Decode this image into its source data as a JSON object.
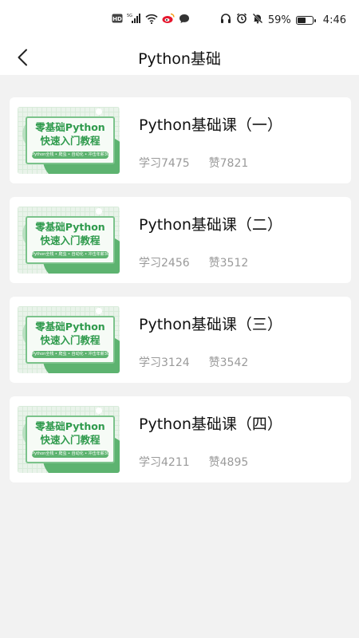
{
  "status_bar": {
    "network_label": "5G",
    "battery_percent": "59%",
    "battery_level": 0.59,
    "time": "4:46",
    "icons": [
      "hd-icon",
      "signal-icon",
      "wifi-icon",
      "weibo-icon",
      "chat-icon",
      "headphones-icon",
      "alarm-icon",
      "mute-icon",
      "battery-icon"
    ]
  },
  "nav": {
    "title": "Python基础"
  },
  "thumb": {
    "line1": "零基础Python",
    "line2": "快速入门教程",
    "strip": "Python全栈 • 爬虫 • 自动化 • 冲击年薪30万"
  },
  "courses": [
    {
      "title": "Python基础课（一）",
      "study": "学习7475",
      "likes": "赞7821"
    },
    {
      "title": "Python基础课（二）",
      "study": "学习2456",
      "likes": "赞3512"
    },
    {
      "title": "Python基础课（三）",
      "study": "学习3124",
      "likes": "赞3542"
    },
    {
      "title": "Python基础课（四）",
      "study": "学习4211",
      "likes": "赞4895"
    }
  ],
  "colors": {
    "accent_green": "#5db370",
    "thumb_text_green": "#2e9a4c",
    "page_bg": "#f2f2f2",
    "muted_text": "#9a9a9a"
  }
}
